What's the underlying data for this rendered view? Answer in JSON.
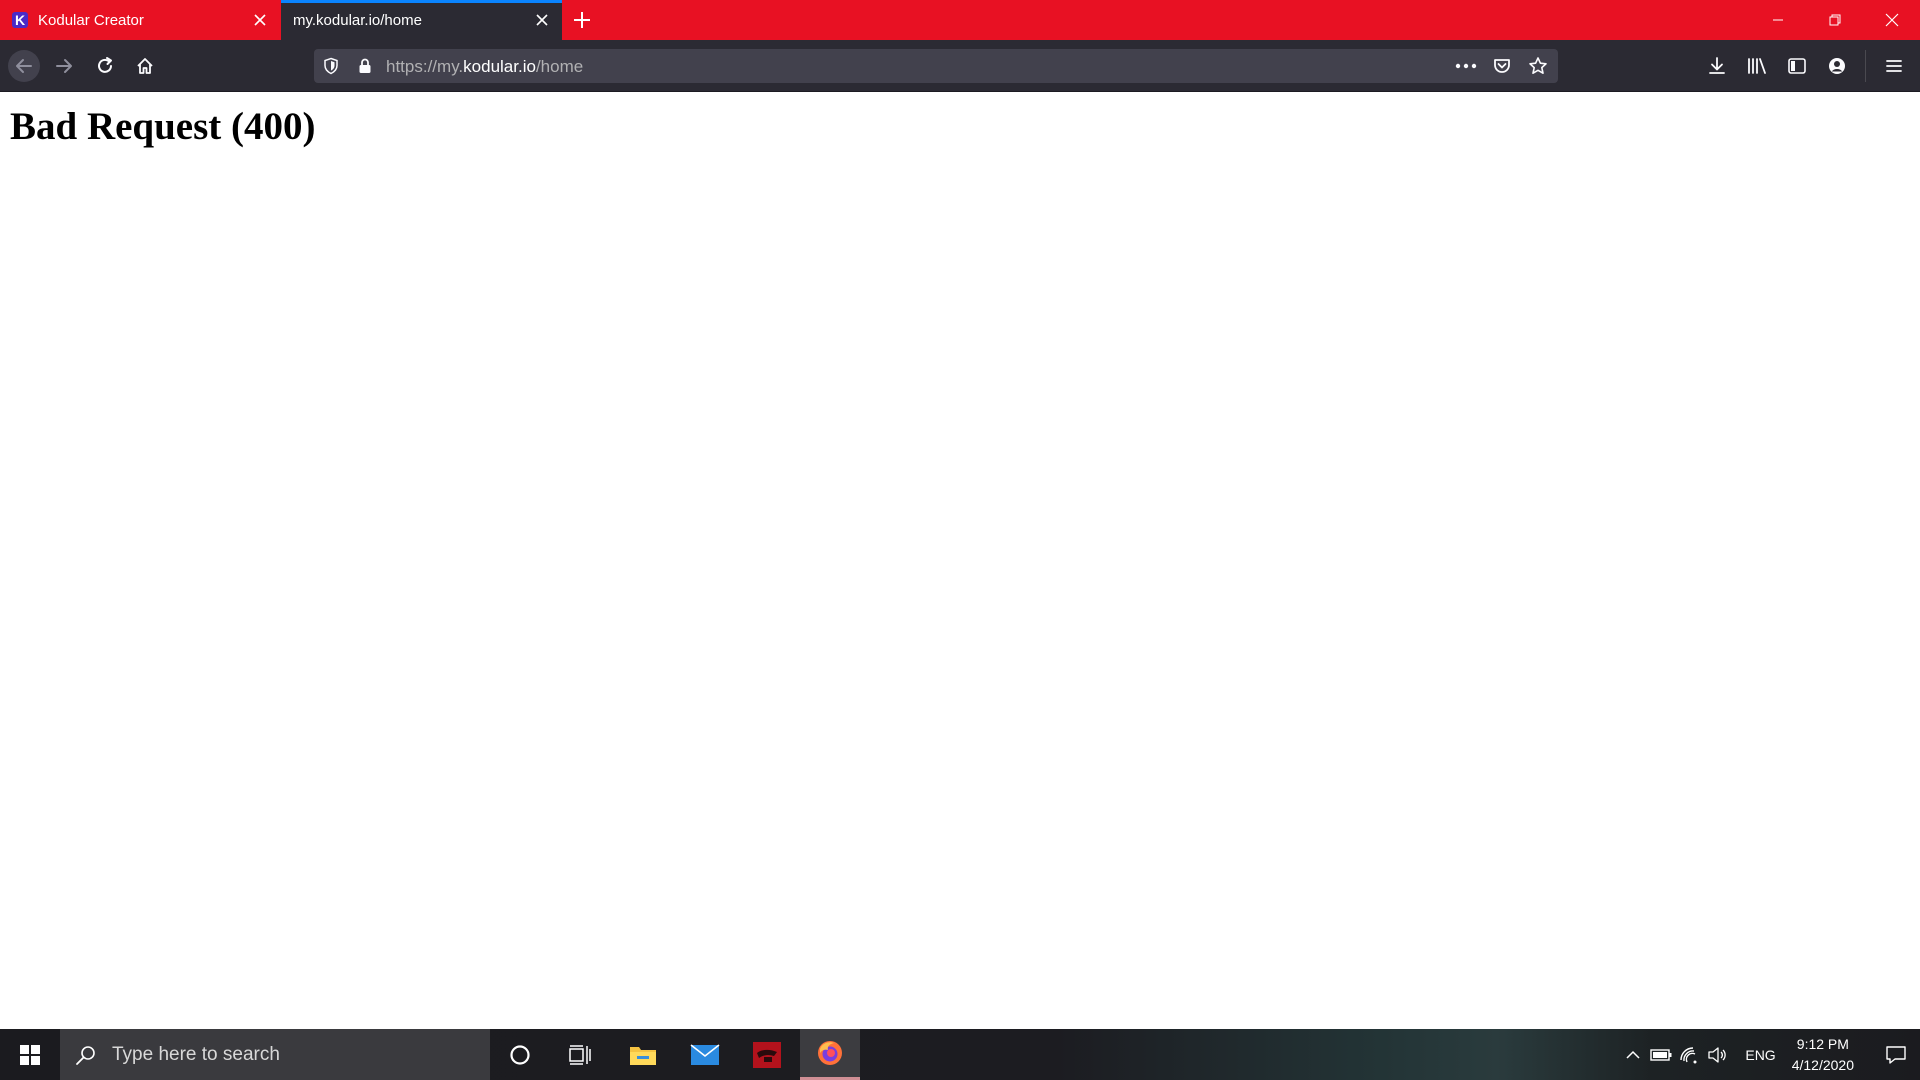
{
  "browser": {
    "tabs": [
      {
        "label": "Kodular Creator",
        "favicon": "K",
        "active": false
      },
      {
        "label": "my.kodular.io/home",
        "active": true
      }
    ],
    "url": {
      "scheme": "https://",
      "subdomain": "my.",
      "host": "kodular.io",
      "path": "/home"
    },
    "theme": {
      "tabstrip_color": "#e81123",
      "toolbar_color": "#2b2a33",
      "urlbar_color": "#42414d",
      "active_tab_accent": "#0a84ff"
    }
  },
  "page": {
    "heading": "Bad Request (400)"
  },
  "taskbar": {
    "search_placeholder": "Type here to search",
    "language": "ENG",
    "time": "9:12 PM",
    "date": "4/12/2020",
    "pinned_apps": [
      "cortana-icon",
      "task-view-icon",
      "file-explorer-icon",
      "mail-icon",
      "red-app-icon",
      "firefox-icon"
    ]
  }
}
